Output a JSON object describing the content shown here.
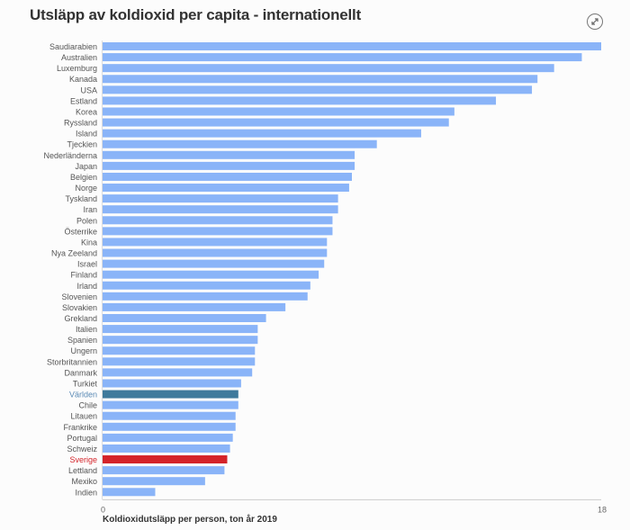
{
  "header": {
    "title": "Utsläpp av koldioxid per capita - internationellt",
    "expand_icon": "expand-icon"
  },
  "colors": {
    "default_bar": "#8ab4f8",
    "highlight_world": "#3f7a9c",
    "highlight_sweden": "#d42329",
    "label_default": "#555555",
    "label_world": "#5a8ab5",
    "label_sweden": "#d42329"
  },
  "chart_data": {
    "type": "bar",
    "orientation": "horizontal",
    "title": "Utsläpp av koldioxid per capita - internationellt",
    "xlabel": "Koldioxidutsläpp per person, ton år 2019",
    "ylabel": "",
    "xlim": [
      0,
      18
    ],
    "x_ticks": [
      "0",
      "18"
    ],
    "grid": false,
    "categories": [
      "Saudiarabien",
      "Australien",
      "Luxemburg",
      "Kanada",
      "USA",
      "Estland",
      "Korea",
      "Ryssland",
      "Island",
      "Tjeckien",
      "Nederländerna",
      "Japan",
      "Belgien",
      "Norge",
      "Tyskland",
      "Iran",
      "Polen",
      "Österrike",
      "Kina",
      "Nya Zeeland",
      "Israel",
      "Finland",
      "Irland",
      "Slovenien",
      "Slovakien",
      "Grekland",
      "Italien",
      "Spanien",
      "Ungern",
      "Storbritannien",
      "Danmark",
      "Turkiet",
      "Världen",
      "Chile",
      "Litauen",
      "Frankrike",
      "Portugal",
      "Schweiz",
      "Sverige",
      "Lettland",
      "Mexiko",
      "Indien"
    ],
    "values": [
      18.0,
      17.3,
      16.3,
      15.7,
      15.5,
      14.2,
      12.7,
      12.5,
      11.5,
      9.9,
      9.1,
      9.1,
      9.0,
      8.9,
      8.5,
      8.5,
      8.3,
      8.3,
      8.1,
      8.1,
      8.0,
      7.8,
      7.5,
      7.4,
      6.6,
      5.9,
      5.6,
      5.6,
      5.5,
      5.5,
      5.4,
      5.0,
      4.9,
      4.9,
      4.8,
      4.8,
      4.7,
      4.6,
      4.5,
      4.4,
      3.7,
      1.9
    ],
    "highlights": {
      "Världen": "world",
      "Sverige": "sweden"
    }
  }
}
